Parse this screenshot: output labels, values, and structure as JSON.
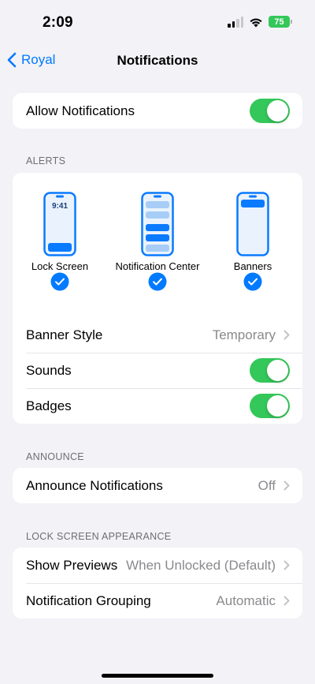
{
  "status_bar": {
    "time": "2:09",
    "battery": "75"
  },
  "nav": {
    "back_label": "Royal",
    "title": "Notifications"
  },
  "allow": {
    "label": "Allow Notifications",
    "enabled": true
  },
  "alerts": {
    "header": "ALERTS",
    "previews": [
      {
        "label": "Lock Screen",
        "screen_time": "9:41",
        "checked": true
      },
      {
        "label": "Notification Center",
        "checked": true
      },
      {
        "label": "Banners",
        "checked": true
      }
    ],
    "banner_style": {
      "label": "Banner Style",
      "value": "Temporary"
    },
    "sounds": {
      "label": "Sounds",
      "enabled": true
    },
    "badges": {
      "label": "Badges",
      "enabled": true
    }
  },
  "announce": {
    "header": "ANNOUNCE",
    "notifications": {
      "label": "Announce Notifications",
      "value": "Off"
    }
  },
  "lock_screen": {
    "header": "LOCK SCREEN APPEARANCE",
    "show_previews": {
      "label": "Show Previews",
      "value": "When Unlocked (Default)"
    },
    "grouping": {
      "label": "Notification Grouping",
      "value": "Automatic"
    }
  },
  "colors": {
    "accent": "#007aff",
    "toggle_on": "#34c759",
    "background": "#f2f2f7",
    "secondary_text": "#8a8a8e"
  }
}
